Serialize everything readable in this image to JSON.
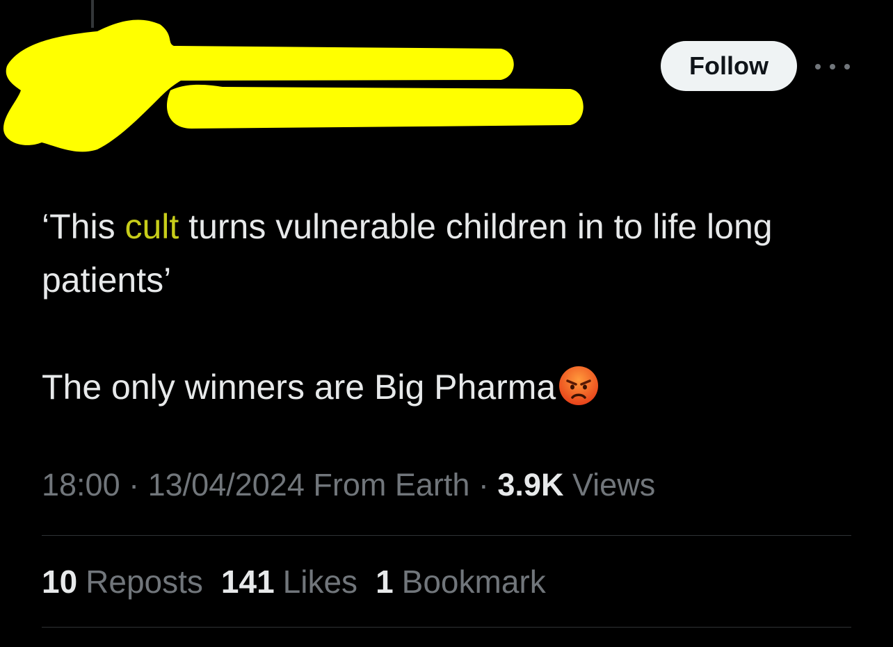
{
  "colors": {
    "background": "#000000",
    "text_primary": "#e7e9ea",
    "text_secondary": "#71767b",
    "highlight_text": "#c7cd1a",
    "redaction_marker": "#ffff00",
    "follow_bg": "#eff3f4"
  },
  "header": {
    "follow_label": "Follow",
    "more_icon": "more-horizontal-icon"
  },
  "tweet": {
    "line1_pre": "‘This ",
    "line1_highlight": "cult",
    "line1_post": " turns vulnerable children in to life long patients’",
    "line2": "The only winners are Big Pharma",
    "emoji": "angry-face-emoji"
  },
  "meta": {
    "time": "18:00",
    "sep1": " · ",
    "date": "13/04/2024",
    "source": " From Earth",
    "sep2": " · ",
    "views_count": "3.9K",
    "views_label": " Views"
  },
  "stats": {
    "reposts_count": "10",
    "reposts_label": "Reposts",
    "likes_count": "141",
    "likes_label": "Likes",
    "bookmarks_count": "1",
    "bookmarks_label": "Bookmark"
  }
}
